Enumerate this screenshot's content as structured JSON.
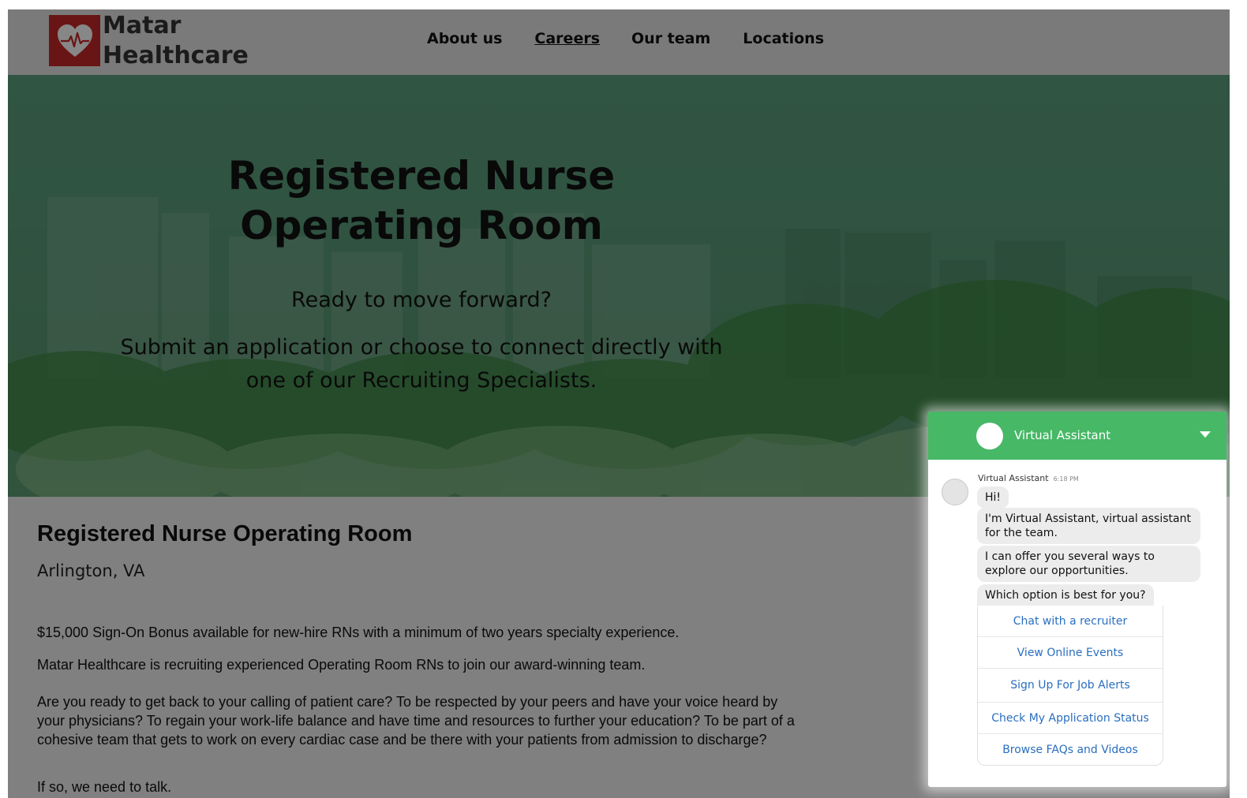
{
  "header": {
    "logo_line1": "Matar",
    "logo_line2": "Healthcare",
    "nav": [
      {
        "label": "About us"
      },
      {
        "label": "Careers"
      },
      {
        "label": "Our team"
      },
      {
        "label": "Locations"
      }
    ]
  },
  "hero": {
    "title_line1": "Registered Nurse",
    "title_line2": "Operating Room",
    "subtitle1": "Ready to move forward?",
    "subtitle2": "Submit an application or choose to connect directly with one of our Recruiting Specialists."
  },
  "job": {
    "title": "Registered Nurse Operating Room",
    "location": "Arlington, VA",
    "paragraphs": [
      "$15,000 Sign-On Bonus available for new-hire RNs with a minimum of two years specialty experience.",
      "Matar Healthcare is recruiting experienced Operating Room RNs to join our award-winning team.",
      "Are you ready to get back to your calling of patient care? To be respected by your peers and have your voice heard by your physicians? To regain your work-life balance and have time and resources to further your education? To be part of a cohesive team that gets to work on every cardiac case and be there with your patients from admission to discharge?",
      "If so, we need to talk."
    ]
  },
  "chat": {
    "title": "Virtual Assistant",
    "sender": "Virtual Assistant",
    "time": "6:18 PM",
    "messages": [
      "Hi!",
      "I'm Virtual Assistant, virtual assistant for the team.",
      "I can offer you several ways to explore our opportunities.",
      "Which option is best for you?"
    ],
    "options": [
      "Chat with a recruiter",
      "View Online Events",
      "Sign Up For Job Alerts",
      "Check My Application Status",
      "Browse FAQs and Videos"
    ]
  },
  "colors": {
    "brand_red": "#c62828",
    "chat_green": "#46b866",
    "link_blue": "#2a6ebf",
    "hero_green": "#5ea07f"
  },
  "icons": {
    "logo": "heart-pulse-icon",
    "collapse": "chevron-down-icon"
  }
}
